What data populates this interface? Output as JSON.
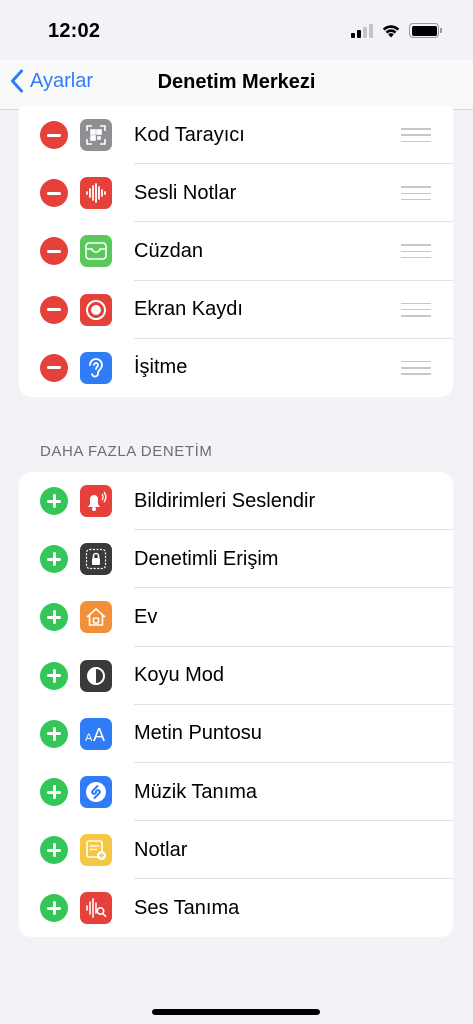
{
  "status_bar": {
    "time": "12:02",
    "icons": [
      "signal-icon",
      "wifi-icon",
      "battery-icon"
    ]
  },
  "nav": {
    "back_label": "Ayarlar",
    "title": "Denetim Merkezi"
  },
  "included_controls": [
    {
      "label": "Kod Tarayıcı",
      "icon": "qr-code-icon",
      "color": "#8e8e93"
    },
    {
      "label": "Sesli Notlar",
      "icon": "waveform-icon",
      "color": "#e5413a"
    },
    {
      "label": "Cüzdan",
      "icon": "wallet-icon",
      "color": "#5ac85a"
    },
    {
      "label": "Ekran Kaydı",
      "icon": "record-icon",
      "color": "#e5413a"
    },
    {
      "label": "İşitme",
      "icon": "ear-icon",
      "color": "#2f7cf6"
    }
  ],
  "more_section_header": "DAHA FAZLA DENETİM",
  "more_controls": [
    {
      "label": "Bildirimleri Seslendir",
      "icon": "announce-bell-icon",
      "color": "#e5413a"
    },
    {
      "label": "Denetimli Erişim",
      "icon": "lock-icon",
      "color": "#3a3a3c"
    },
    {
      "label": "Ev",
      "icon": "home-icon",
      "color": "#f2903a"
    },
    {
      "label": "Koyu Mod",
      "icon": "dark-mode-icon",
      "color": "#3a3a3c"
    },
    {
      "label": "Metin Puntosu",
      "icon": "text-size-icon",
      "color": "#2f7cf6"
    },
    {
      "label": "Müzik Tanıma",
      "icon": "shazam-icon",
      "color": "#2f7cf6"
    },
    {
      "label": "Notlar",
      "icon": "notes-icon",
      "color": "#f6c744"
    },
    {
      "label": "Ses Tanıma",
      "icon": "sound-recognition-icon",
      "color": "#e5413a"
    }
  ],
  "colors": {
    "accent": "#2f7cf6",
    "remove": "#e5413a",
    "add": "#34c659",
    "background": "#f2f2f7"
  }
}
